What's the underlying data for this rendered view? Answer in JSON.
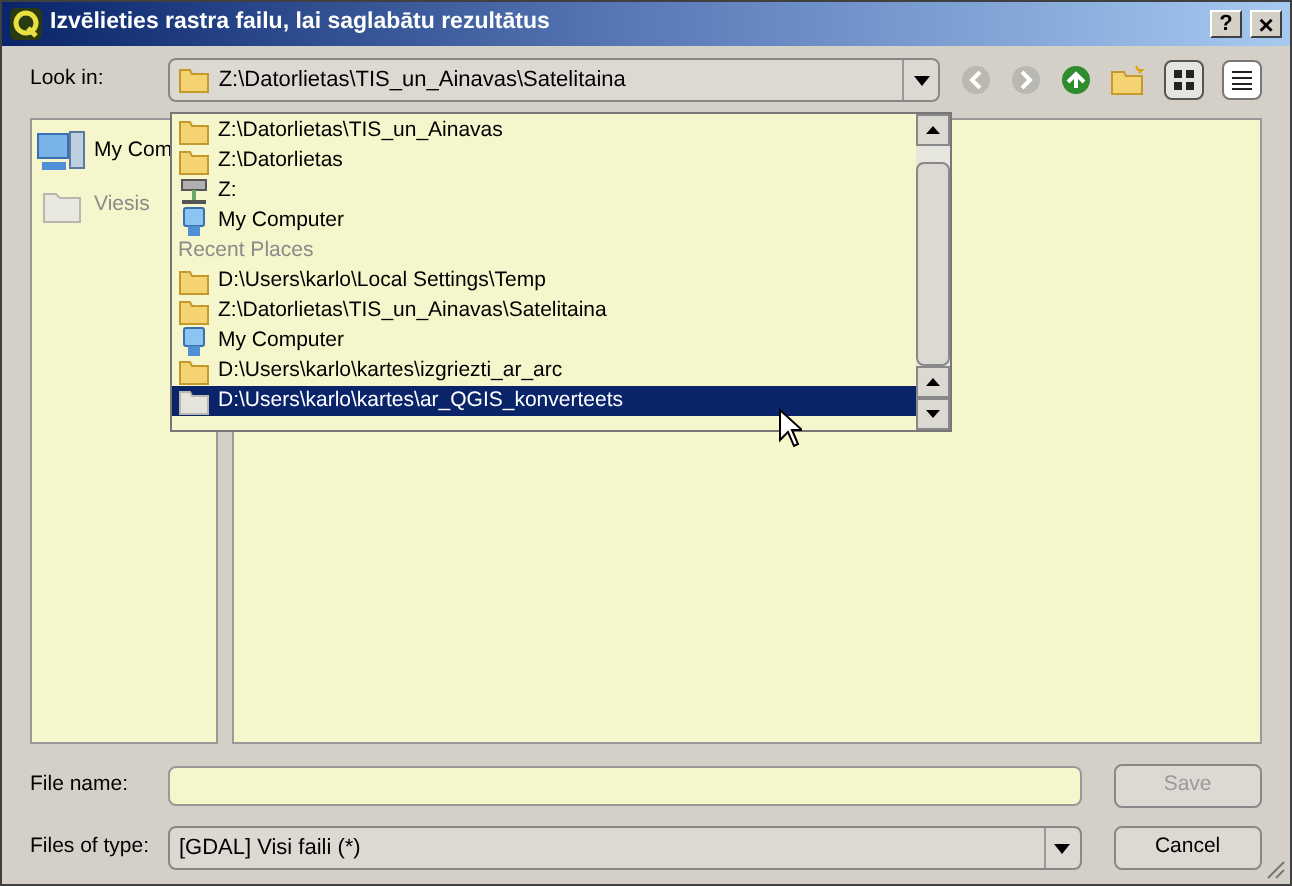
{
  "window": {
    "title": "Izvēlieties rastra failu, lai saglabātu rezultātus",
    "help_button": "?",
    "close_button": "×"
  },
  "look_in": {
    "label": "Look in:",
    "value": "Z:\\Datorlietas\\TIS_un_Ainavas\\Satelitaina"
  },
  "toolbar": [
    {
      "kind": "back",
      "disabled": true
    },
    {
      "kind": "forward",
      "disabled": true
    },
    {
      "kind": "up",
      "disabled": false
    },
    {
      "kind": "new-folder",
      "disabled": false
    },
    {
      "kind": "icons",
      "selected": true
    },
    {
      "kind": "list",
      "selected": false
    }
  ],
  "sidebar": {
    "items": [
      {
        "kind": "computer",
        "label": "My Com",
        "disabled": false
      },
      {
        "kind": "folder",
        "label": "Viesis",
        "disabled": true
      }
    ]
  },
  "dropdown": {
    "items": [
      {
        "kind": "folder",
        "label": "Z:\\Datorlietas\\TIS_un_Ainavas",
        "selected": false
      },
      {
        "kind": "folder",
        "label": "Z:\\Datorlietas",
        "selected": false
      },
      {
        "kind": "drive",
        "label": "Z:",
        "selected": false
      },
      {
        "kind": "computer",
        "label": "My Computer",
        "selected": false
      },
      {
        "kind": "heading",
        "label": "Recent Places"
      },
      {
        "kind": "folder",
        "label": "D:\\Users\\karlo\\Local Settings\\Temp",
        "selected": false
      },
      {
        "kind": "folder",
        "label": "Z:\\Datorlietas\\TIS_un_Ainavas\\Satelitaina",
        "selected": false
      },
      {
        "kind": "computer",
        "label": "My Computer",
        "selected": false
      },
      {
        "kind": "folder",
        "label": "D:\\Users\\karlo\\kartes\\izgriezti_ar_arc",
        "selected": false
      },
      {
        "kind": "folder",
        "label": "D:\\Users\\karlo\\kartes\\ar_QGIS_konverteets",
        "selected": true
      }
    ]
  },
  "file_name": {
    "label": "File name:"
  },
  "files_of_type": {
    "label": "Files of type:",
    "value": "[GDAL] Visi faili (*)"
  },
  "buttons": [
    {
      "label": "Save",
      "disabled": true
    },
    {
      "label": "Cancel",
      "disabled": false
    }
  ]
}
